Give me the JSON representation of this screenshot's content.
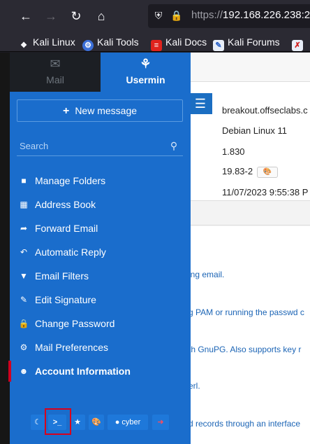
{
  "browser": {
    "url_prefix": "https://",
    "url_host": "192.168.226.238:2",
    "nav": {
      "back_icon": "back-arrow-icon",
      "forward_icon": "forward-arrow-icon",
      "reload_icon": "reload-icon",
      "home_icon": "home-icon"
    },
    "bookmarks": [
      {
        "label": "Kali Linux",
        "icon": "kali-dragon-icon"
      },
      {
        "label": "Kali Tools",
        "icon": "kali-tools-icon"
      },
      {
        "label": "Kali Docs",
        "icon": "kali-docs-icon"
      },
      {
        "label": "Kali Forums",
        "icon": "kali-forums-icon"
      },
      {
        "label": "",
        "icon": "kali-icon"
      }
    ]
  },
  "sidebar": {
    "tabs": [
      {
        "label": "Mail",
        "icon": "envelope-icon"
      },
      {
        "label": "Usermin",
        "icon": "usermin-logo-icon"
      }
    ],
    "new_message": "New message",
    "search_placeholder": "Search",
    "menu": [
      {
        "label": "Manage Folders",
        "icon": "folder-icon"
      },
      {
        "label": "Address Book",
        "icon": "address-book-icon"
      },
      {
        "label": "Forward Email",
        "icon": "share-icon"
      },
      {
        "label": "Automatic Reply",
        "icon": "reply-all-icon"
      },
      {
        "label": "Email Filters",
        "icon": "filter-icon"
      },
      {
        "label": "Edit Signature",
        "icon": "pencil-icon"
      },
      {
        "label": "Change Password",
        "icon": "lock-icon"
      },
      {
        "label": "Mail Preferences",
        "icon": "gear-icon"
      },
      {
        "label": "Account Information",
        "icon": "user-circle-icon"
      }
    ],
    "footer": {
      "user": "cyber",
      "buttons": [
        "moon-icon",
        "terminal-icon",
        "star-icon",
        "palette-icon",
        "user-icon",
        "logout-icon"
      ]
    }
  },
  "main": {
    "info_rows": [
      "breakout.offseclabs.c",
      "Debian Linux 11",
      "1.830",
      "19.83-2",
      "11/07/2023 9:55:38 P"
    ],
    "descriptions": [
      "ing email.",
      "g PAM or running the passwd c",
      "th GnuPG. Also supports key r",
      "erl.",
      "d records through an interface"
    ]
  },
  "colors": {
    "sidebar": "#1a6dcc",
    "active_marker": "#d00020",
    "highlight_box": "#d8001c"
  }
}
